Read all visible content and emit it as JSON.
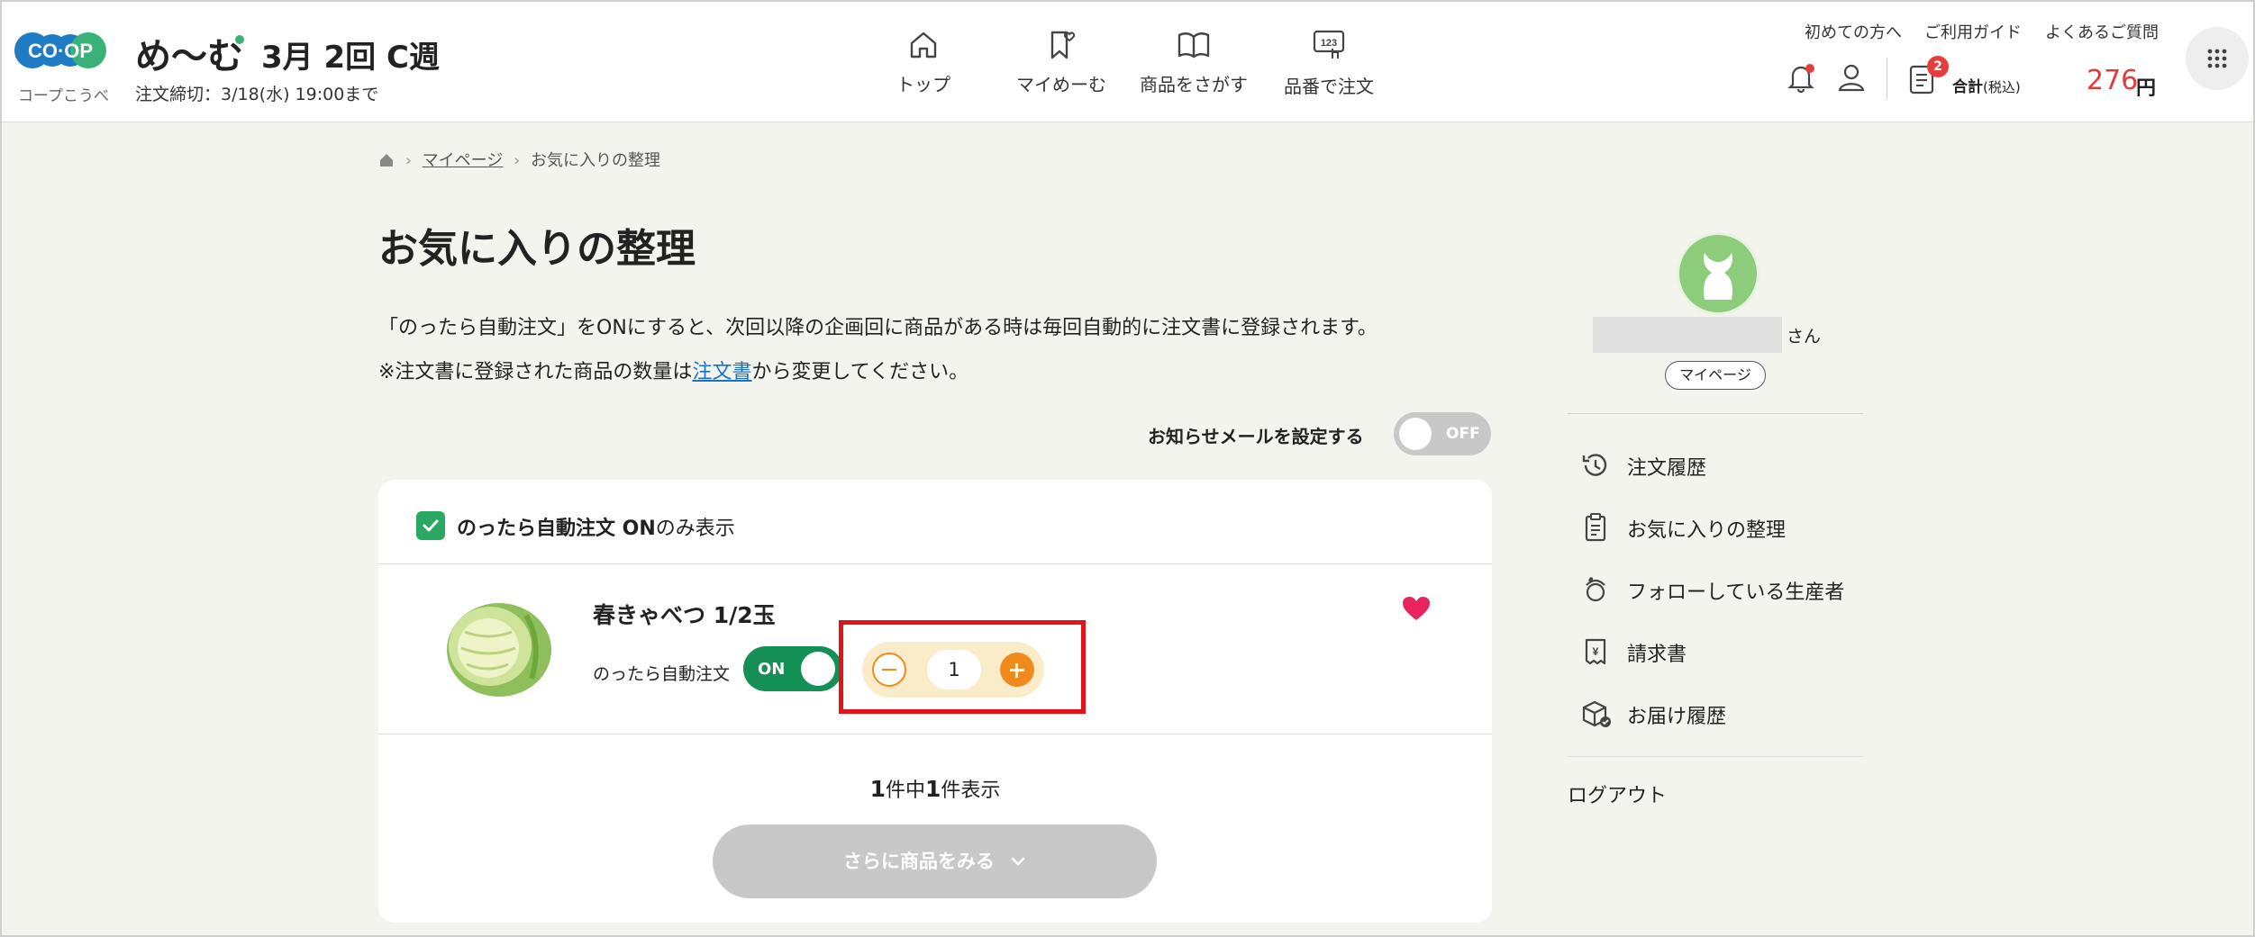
{
  "header": {
    "logo_text": "CO-OP",
    "logo_sub": "コープこうべ",
    "brand": "め〜む",
    "week": "3月 2回 C週",
    "deadline": "注文締切：3/18(水) 19:00まで",
    "nav": [
      {
        "label": "トップ",
        "icon": "home-icon"
      },
      {
        "label": "マイめーむ",
        "icon": "bookmark-heart-icon"
      },
      {
        "label": "商品をさがす",
        "icon": "book-icon"
      },
      {
        "label": "品番で注文",
        "icon": "number-touch-icon"
      }
    ],
    "top_links": [
      "初めての方へ",
      "ご利用ガイド",
      "よくあるご質問"
    ],
    "cart_badge": "2",
    "total_label": "合計",
    "total_tax": "(税込)",
    "total_amount": "276",
    "total_unit": "円"
  },
  "breadcrumb": {
    "home_icon": "home-icon",
    "mypage": "マイページ",
    "current": "お気に入りの整理"
  },
  "page": {
    "title": "お気に入りの整理",
    "desc1": "「のったら自動注文」をONにすると、次回以降の企画回に商品がある時は毎回自動的に注文書に登録されます。",
    "desc2_prefix": "※注文書に登録された商品の数量は",
    "desc2_link": "注文書",
    "desc2_suffix": "から変更してください。",
    "notify_label": "お知らせメールを設定する",
    "notify_toggle": "OFF"
  },
  "filter": {
    "checked": true,
    "label_bold": "のったら自動注文 ON",
    "label_rest": "のみ表示"
  },
  "products": [
    {
      "name": "春きゃべつ 1/2玉",
      "auto_label": "のったら自動注文",
      "auto_toggle": "ON",
      "quantity": "1",
      "favorite": true
    }
  ],
  "count": {
    "total": "1",
    "mid": "件中",
    "shown": "1",
    "suffix": "件表示"
  },
  "more_button": "さらに商品をみる",
  "sidebar": {
    "san": "さん",
    "mypage_button": "マイページ",
    "items": [
      {
        "label": "注文履歴",
        "icon": "history-icon"
      },
      {
        "label": "お気に入りの整理",
        "icon": "clipboard-list-icon"
      },
      {
        "label": "フォローしている生産者",
        "icon": "producer-icon"
      },
      {
        "label": "請求書",
        "icon": "invoice-icon"
      },
      {
        "label": "お届け履歴",
        "icon": "delivery-box-icon"
      }
    ],
    "logout": "ログアウト"
  },
  "colors": {
    "accent_orange": "#f08a1c",
    "toggle_on": "#148f55",
    "price_red": "#e33b3b",
    "highlight_red": "#e0141a",
    "heart": "#e8245a"
  }
}
